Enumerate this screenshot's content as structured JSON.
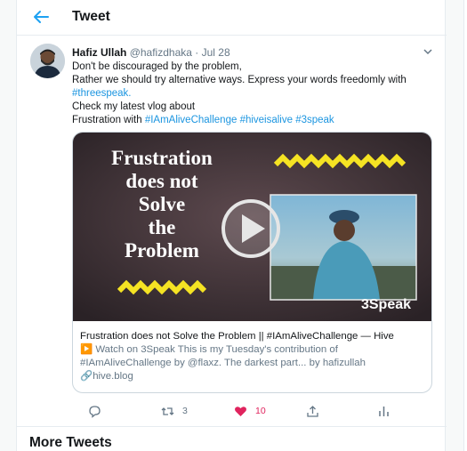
{
  "header": {
    "title": "Tweet"
  },
  "tweet": {
    "author_name": "Hafiz Ullah",
    "handle": "@hafizdhaka",
    "separator": "·",
    "date": "Jul 28",
    "lines": [
      {
        "plain": "Don't be discouraged by the problem,",
        "link": ""
      },
      {
        "plain": "Rather we should try alternative ways. Express your words freedomly with",
        "link": ""
      },
      {
        "plain": "",
        "link": "#threespeak."
      },
      {
        "plain": "Check my latest vlog about",
        "link": ""
      },
      {
        "plain": "Frustration with ",
        "link": "#IAmAliveChallenge #hiveisalive #3speak"
      }
    ]
  },
  "card": {
    "thumbnail": {
      "headline_lines": [
        "Frustration",
        "does not",
        "Solve",
        "the",
        "Problem"
      ],
      "logo_text": "3Speak",
      "play_icon": "play-icon"
    },
    "title": "Frustration does not Solve the Problem || #IAmAliveChallenge — Hive",
    "description_line1": "▶️ Watch on 3Speak This is my Tuesday's contribution of",
    "description_line2": "#IAmAliveChallenge by @flaxz. The darkest part... by hafizullah",
    "url": "hive.blog"
  },
  "actions": {
    "reply": {
      "icon": "reply-icon",
      "count": ""
    },
    "retweet": {
      "icon": "retweet-icon",
      "count": "3"
    },
    "like": {
      "icon": "heart-icon",
      "count": "10"
    },
    "share": {
      "icon": "share-icon",
      "count": ""
    },
    "analytics": {
      "icon": "analytics-icon",
      "count": ""
    }
  },
  "more_tweets": {
    "title": "More Tweets"
  },
  "colors": {
    "accent": "#1da1f2",
    "like": "#e0245e",
    "secondary": "#657786",
    "yellow_zigzag": "#f5e323"
  }
}
